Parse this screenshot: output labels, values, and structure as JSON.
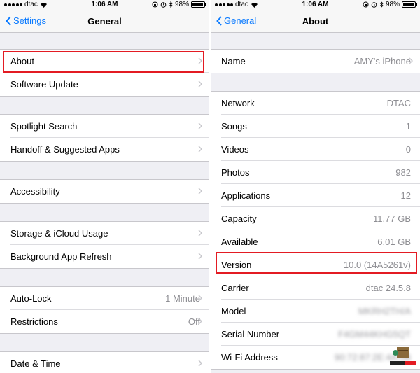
{
  "status": {
    "left": {
      "carrier": "dtac",
      "time": "1:06 AM",
      "battery": "98%"
    },
    "right": {
      "carrier": "dtac",
      "time": "1:06 AM",
      "battery": "98%"
    }
  },
  "general": {
    "back_label": "Settings",
    "title": "General",
    "groups": [
      [
        {
          "label": "About"
        },
        {
          "label": "Software Update"
        }
      ],
      [
        {
          "label": "Spotlight Search"
        },
        {
          "label": "Handoff & Suggested Apps"
        }
      ],
      [
        {
          "label": "Accessibility"
        }
      ],
      [
        {
          "label": "Storage & iCloud Usage"
        },
        {
          "label": "Background App Refresh"
        }
      ],
      [
        {
          "label": "Auto-Lock",
          "value": "1 Minute"
        },
        {
          "label": "Restrictions",
          "value": "Off"
        }
      ],
      [
        {
          "label": "Date & Time"
        }
      ]
    ]
  },
  "about": {
    "back_label": "General",
    "title": "About",
    "groups": [
      [
        {
          "label": "Name",
          "value": "AMY's iPhone"
        }
      ],
      [
        {
          "label": "Network",
          "value": "DTAC"
        },
        {
          "label": "Songs",
          "value": "1"
        },
        {
          "label": "Videos",
          "value": "0"
        },
        {
          "label": "Photos",
          "value": "982"
        },
        {
          "label": "Applications",
          "value": "12"
        },
        {
          "label": "Capacity",
          "value": "11.77 GB"
        },
        {
          "label": "Available",
          "value": "6.01 GB"
        },
        {
          "label": "Version",
          "value": "10.0 (14A5261v)"
        },
        {
          "label": "Carrier",
          "value": "dtac 24.5.8"
        },
        {
          "label": "Model",
          "value": "MKRH2TH/A"
        },
        {
          "label": "Serial Number",
          "value": "F4GM44KHG5QT"
        },
        {
          "label": "Wi-Fi Address",
          "value": "90:72:87:2E:4A:0B"
        }
      ]
    ]
  },
  "colors": {
    "accent": "#0a7aff",
    "highlight": "#e31b23"
  },
  "icons": [
    "chevron-left-icon",
    "chevron-right-icon",
    "wifi-icon",
    "alarm-icon",
    "bluetooth-icon",
    "lock-rotation-icon"
  ]
}
